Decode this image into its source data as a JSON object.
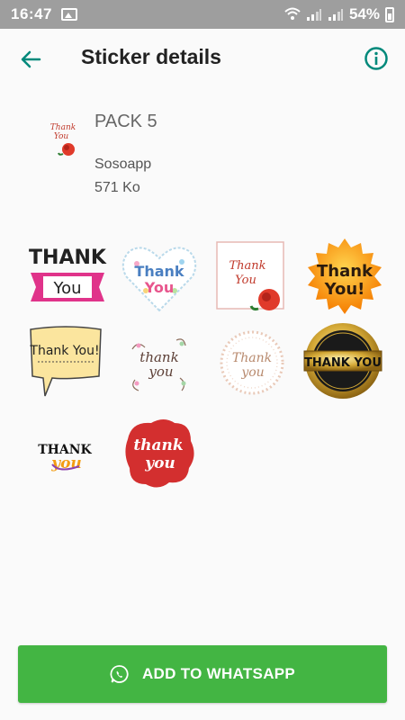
{
  "status_bar": {
    "time": "16:47",
    "battery": "54%"
  },
  "toolbar": {
    "title": "Sticker details",
    "back_icon": "arrow-back-icon",
    "info_icon": "info-icon"
  },
  "pack": {
    "name": "PACK 5",
    "author": "Sosoapp",
    "size": "571 Ko",
    "tray_text": [
      "Thank",
      "You"
    ]
  },
  "stickers": [
    {
      "lines": [
        "THANK",
        "You"
      ]
    },
    {
      "lines": [
        "Thank",
        "You"
      ]
    },
    {
      "lines": [
        "Thank",
        "You"
      ]
    },
    {
      "lines": [
        "Thank",
        "You!"
      ]
    },
    {
      "lines": [
        "Thank You!"
      ]
    },
    {
      "lines": [
        "thank",
        "you"
      ]
    },
    {
      "lines": [
        "Thank",
        "you"
      ]
    },
    {
      "lines": [
        "THANK YOU"
      ]
    },
    {
      "lines": [
        "THANK",
        "you"
      ]
    },
    {
      "lines": [
        "thank",
        "you"
      ]
    }
  ],
  "add_button": {
    "label": "ADD TO WHATSAPP"
  },
  "colors": {
    "accent": "#00897b",
    "button": "#43b543",
    "status_bar": "#9e9e9e"
  }
}
